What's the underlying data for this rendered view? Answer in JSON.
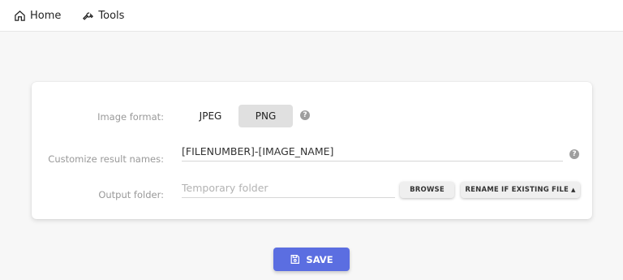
{
  "nav": {
    "home_label": "Home",
    "tools_label": "Tools"
  },
  "form": {
    "image_format": {
      "label": "Image format:",
      "options": [
        "JPEG",
        "PNG"
      ],
      "selected": "PNG"
    },
    "result_names": {
      "label": "Customize result names:",
      "value": "[FILENUMBER]-[IMAGE_NAME]"
    },
    "output_folder": {
      "label": "Output folder:",
      "placeholder": "Temporary folder",
      "browse_label": "BROWSE",
      "conflict_label": "RENAME IF EXISTING FILE"
    },
    "help_glyph": "?"
  },
  "save_label": "SAVE",
  "colors": {
    "accent": "#5b6ee1",
    "selected_bg": "#e0e0e0"
  }
}
